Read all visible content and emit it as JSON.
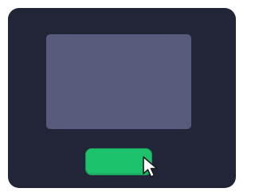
{
  "theme": {
    "window_bg": "#222537",
    "screen_bg": "#585a7c",
    "button_bg": "#1ec26d",
    "cursor_fill": "#ffffff",
    "cursor_stroke": "#1a1a1a"
  },
  "window": {
    "screen": {
      "content": ""
    },
    "action_button": {
      "label": ""
    }
  },
  "pointer": {
    "icon": "arrow-cursor-icon"
  }
}
